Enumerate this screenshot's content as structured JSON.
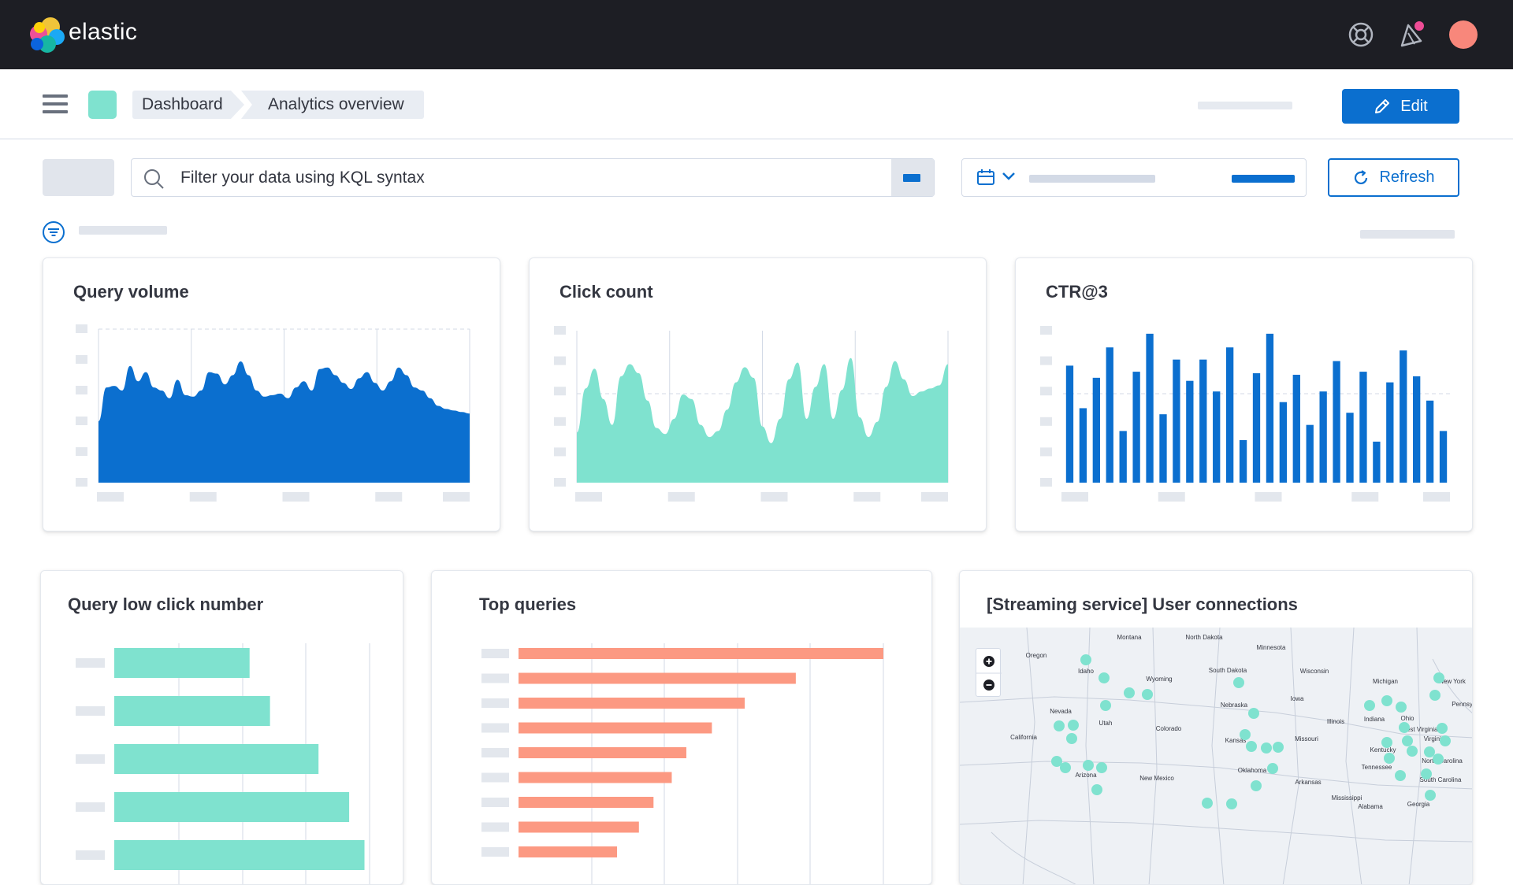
{
  "app": {
    "brand": "elastic"
  },
  "colors": {
    "accent": "#0b6fcf",
    "teal": "#7fe2cf",
    "salmon": "#fc9982",
    "topbar": "#1d1e24",
    "avatar": "#f8877b"
  },
  "topbar": {
    "icons": [
      "help-icon",
      "newsfeed-icon",
      "avatar"
    ]
  },
  "breadcrumbs": [
    "Dashboard",
    "Analytics overview"
  ],
  "toolbar": {
    "edit_label": "Edit",
    "refresh_label": "Refresh"
  },
  "search": {
    "placeholder": "Filter your data using KQL syntax"
  },
  "panels": {
    "query_volume": {
      "title": "Query volume"
    },
    "click_count": {
      "title": "Click count"
    },
    "ctr": {
      "title": "CTR@3"
    },
    "low_click": {
      "title": "Query low click number"
    },
    "top_queries": {
      "title": "Top queries"
    },
    "user_connections": {
      "title": "[Streaming service] User connections"
    }
  },
  "chart_data": [
    {
      "type": "area",
      "title": "Query volume",
      "y": [
        0.4,
        0.62,
        0.63,
        0.6,
        0.76,
        0.66,
        0.72,
        0.62,
        0.6,
        0.55,
        0.67,
        0.57,
        0.56,
        0.6,
        0.72,
        0.71,
        0.64,
        0.7,
        0.79,
        0.7,
        0.6,
        0.56,
        0.57,
        0.58,
        0.55,
        0.62,
        0.66,
        0.6,
        0.74,
        0.75,
        0.7,
        0.65,
        0.61,
        0.68,
        0.72,
        0.65,
        0.6,
        0.66,
        0.75,
        0.7,
        0.62,
        0.6,
        0.55,
        0.5,
        0.48,
        0.47,
        0.46,
        0.45
      ],
      "ylim": [
        0,
        1
      ],
      "grid": true
    },
    {
      "type": "area",
      "title": "Click count",
      "y": [
        0.33,
        0.62,
        0.75,
        0.55,
        0.38,
        0.7,
        0.78,
        0.72,
        0.54,
        0.36,
        0.32,
        0.42,
        0.58,
        0.55,
        0.38,
        0.3,
        0.34,
        0.48,
        0.66,
        0.76,
        0.69,
        0.37,
        0.26,
        0.42,
        0.68,
        0.79,
        0.42,
        0.63,
        0.78,
        0.42,
        0.61,
        0.82,
        0.43,
        0.3,
        0.4,
        0.63,
        0.8,
        0.68,
        0.57,
        0.6,
        0.62,
        0.64,
        0.78
      ],
      "ylim": [
        0,
        1
      ],
      "grid": true
    },
    {
      "type": "bar",
      "title": "CTR@3",
      "values": [
        0.77,
        0.49,
        0.69,
        0.89,
        0.34,
        0.73,
        0.98,
        0.45,
        0.81,
        0.67,
        0.81,
        0.6,
        0.89,
        0.28,
        0.72,
        0.98,
        0.53,
        0.71,
        0.38,
        0.6,
        0.8,
        0.46,
        0.73,
        0.27,
        0.66,
        0.87,
        0.7,
        0.54,
        0.34
      ],
      "ylim": [
        0,
        1
      ],
      "grid": true
    },
    {
      "type": "bar",
      "title": "Query low click number",
      "orientation": "horizontal",
      "values": [
        0.53,
        0.61,
        0.8,
        0.92,
        0.98
      ],
      "xlim": [
        0,
        1
      ]
    },
    {
      "type": "bar",
      "title": "Top queries",
      "orientation": "horizontal",
      "values": [
        1.0,
        0.76,
        0.62,
        0.53,
        0.46,
        0.42,
        0.37,
        0.33,
        0.27
      ],
      "xlim": [
        0,
        1
      ]
    }
  ],
  "map": {
    "states": [
      "Montana",
      "North Dakota",
      "Minnesota",
      "Oregon",
      "Idaho",
      "South Dakota",
      "Wisconsin",
      "Wyoming",
      "Michigan",
      "New York",
      "Iowa",
      "Nebraska",
      "Pennsylvania",
      "Nevada",
      "Utah",
      "Illinois",
      "Indiana",
      "Ohio",
      "West Virginia",
      "Virginia",
      "Colorado",
      "California",
      "Kansas",
      "Missouri",
      "Kentucky",
      "North Carolina",
      "Tennessee",
      "Oklahoma",
      "Arizona",
      "South Carolina",
      "New Mexico",
      "Arkansas",
      "Mississippi",
      "Georgia",
      "Alabama"
    ],
    "zoom_in": "+",
    "zoom_out": "−"
  }
}
